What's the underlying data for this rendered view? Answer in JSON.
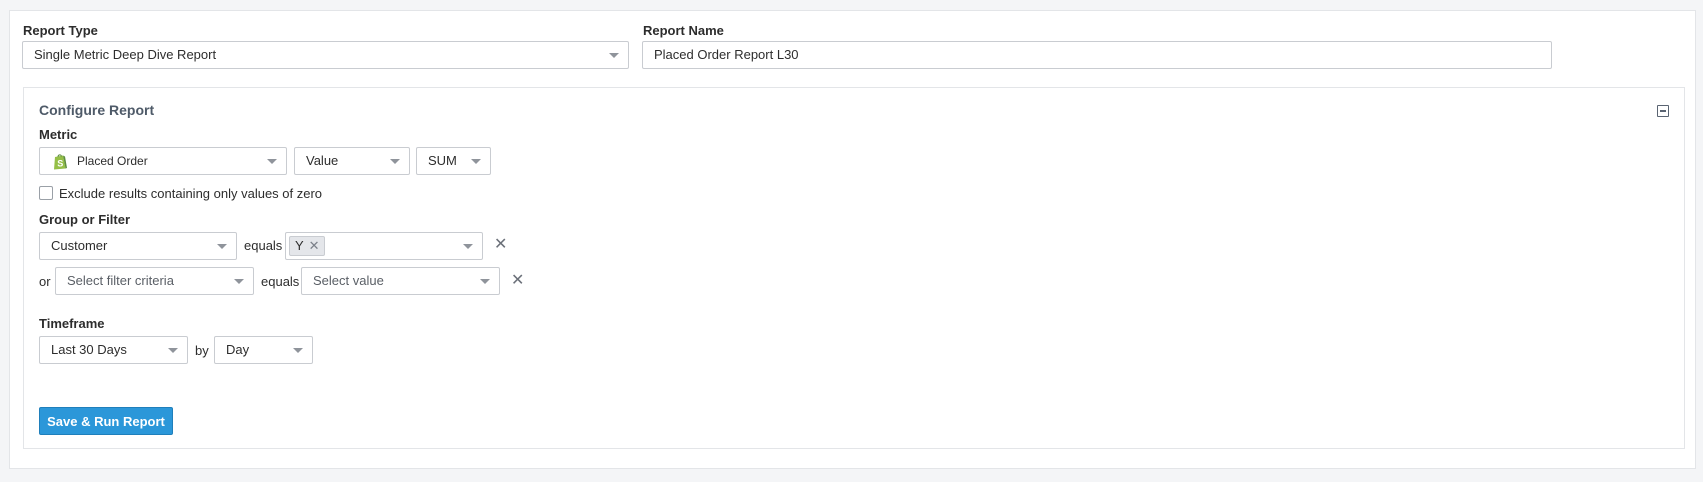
{
  "header": {
    "report_type_label": "Report Type",
    "report_type_value": "Single Metric Deep Dive Report",
    "report_name_label": "Report Name",
    "report_name_value": "Placed Order Report L30"
  },
  "configure": {
    "title": "Configure Report",
    "metric_label": "Metric",
    "metric_value": "Placed Order",
    "metric_icon": "shopify-icon",
    "measure_value": "Value",
    "aggregation_value": "SUM",
    "exclude_zero_label": "Exclude results containing only values of zero",
    "exclude_zero_checked": false,
    "group_filter_label": "Group or Filter",
    "filters": [
      {
        "prefix": "",
        "criteria": "Customer",
        "operator": "equals",
        "values": [
          "Y"
        ],
        "value_placeholder": ""
      },
      {
        "prefix": "or",
        "criteria": "Select filter criteria",
        "operator": "equals",
        "values": [],
        "value_placeholder": "Select value"
      }
    ],
    "timeframe_label": "Timeframe",
    "timeframe_value": "Last 30 Days",
    "by_label": "by",
    "interval_value": "Day",
    "submit_label": "Save & Run Report"
  },
  "colors": {
    "primary_button": "#2b97d9",
    "panel_title": "#4e5a68",
    "shopify_green": "#95bf47"
  }
}
